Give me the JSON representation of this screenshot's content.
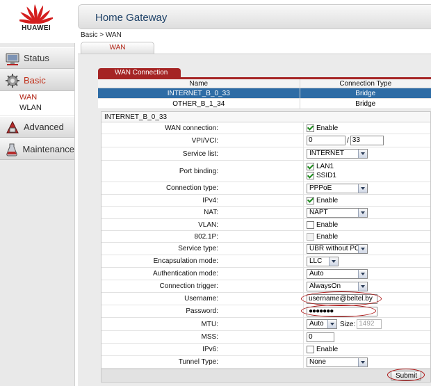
{
  "brand": {
    "logo_text": "HUAWEI",
    "accent": "#d41e1e"
  },
  "header": {
    "title": "Home Gateway"
  },
  "breadcrumb": "Basic > WAN",
  "tabs": {
    "wan": "WAN"
  },
  "sidebar": {
    "items": [
      {
        "label": "Status",
        "icon": "status-icon"
      },
      {
        "label": "Basic",
        "icon": "basic-icon",
        "active": true
      },
      {
        "label": "Advanced",
        "icon": "advanced-icon"
      },
      {
        "label": "Maintenance",
        "icon": "maintenance-icon"
      }
    ],
    "basic_sub": [
      {
        "label": "WAN",
        "active": true
      },
      {
        "label": "WLAN"
      }
    ]
  },
  "connections": {
    "tab_label": "WAN Connection",
    "columns": [
      "Name",
      "Connection Type"
    ],
    "rows": [
      {
        "name": "INTERNET_B_0_33",
        "type": "Bridge",
        "selected": true
      },
      {
        "name": "OTHER_B_1_34",
        "type": "Bridge"
      }
    ]
  },
  "form": {
    "title": "INTERNET_B_0_33",
    "enable_text": "Enable",
    "wan_connection": {
      "label": "WAN connection:",
      "checked": true
    },
    "vpi_vci": {
      "label": "VPI/VCI:",
      "vpi": "0",
      "sep": "/",
      "vci": "33"
    },
    "service_list": {
      "label": "Service list:",
      "value": "INTERNET"
    },
    "port_binding": {
      "label": "Port binding:",
      "ports": [
        {
          "name": "LAN1",
          "checked": true
        },
        {
          "name": "SSID1",
          "checked": true
        }
      ]
    },
    "connection_type": {
      "label": "Connection type:",
      "value": "PPPoE"
    },
    "ipv4": {
      "label": "IPv4:",
      "checked": true
    },
    "nat": {
      "label": "NAT:",
      "value": "NAPT"
    },
    "vlan": {
      "label": "VLAN:",
      "checked": false
    },
    "p8021": {
      "label": "802.1P:",
      "checked": false
    },
    "service_type": {
      "label": "Service type:",
      "value": "UBR without PCR"
    },
    "encapsulation": {
      "label": "Encapsulation mode:",
      "value": "LLC"
    },
    "authentication": {
      "label": "Authentication mode:",
      "value": "Auto"
    },
    "trigger": {
      "label": "Connection trigger:",
      "value": "AlwaysOn"
    },
    "username": {
      "label": "Username:",
      "value": "username@beltel.by"
    },
    "password": {
      "label": "Password:",
      "value": "●●●●●●●"
    },
    "mtu": {
      "label": "MTU:",
      "value": "Auto",
      "size_label": "Size:",
      "size_value": "1492"
    },
    "mss": {
      "label": "MSS:",
      "value": "0"
    },
    "ipv6": {
      "label": "IPv6:",
      "checked": false
    },
    "tunnel": {
      "label": "Tunnel Type:",
      "value": "None"
    },
    "submit": "Submit"
  }
}
